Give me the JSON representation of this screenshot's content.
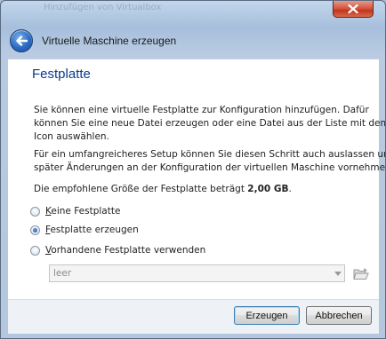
{
  "window": {
    "title": "Virtuelle Maschine erzeugen",
    "background_title": "Hinzufügen von Virtualbox"
  },
  "page": {
    "heading": "Festplatte",
    "paragraph1_line1": "Sie können eine virtuelle Festplatte zur Konfiguration hinzufügen. Dafür",
    "paragraph1_line2": "können Sie eine neue Datei erzeugen oder eine Datei aus der Liste mit dem",
    "paragraph1_line3": "Icon auswählen.",
    "paragraph2_line1": "Für ein umfangreicheres Setup können Sie diesen Schritt auch auslassen und",
    "paragraph2_line2": "später Änderungen an der Konfiguration der virtuellen Maschine vornehmen.",
    "recommended_prefix": "Die empfohlene Größe der Festplatte beträgt ",
    "recommended_size": "2,00 GB",
    "recommended_suffix": "."
  },
  "options": [
    {
      "mnemonic": "K",
      "rest": "eine Festplatte",
      "checked": false
    },
    {
      "mnemonic": "F",
      "rest": "estplatte erzeugen",
      "checked": true
    },
    {
      "mnemonic": "V",
      "rest": "orhandene Festplatte verwenden",
      "checked": false
    }
  ],
  "disk_select": {
    "value": "leer"
  },
  "buttons": {
    "create": "Erzeugen",
    "cancel": "Abbrechen"
  },
  "colors": {
    "heading": "#0a3a8c",
    "accent": "#2a6bc4",
    "close": "#c2341c"
  },
  "icons": {
    "close": "close-icon",
    "back": "back-arrow-icon",
    "dropdown": "chevron-down-icon",
    "folder": "open-folder-icon"
  }
}
